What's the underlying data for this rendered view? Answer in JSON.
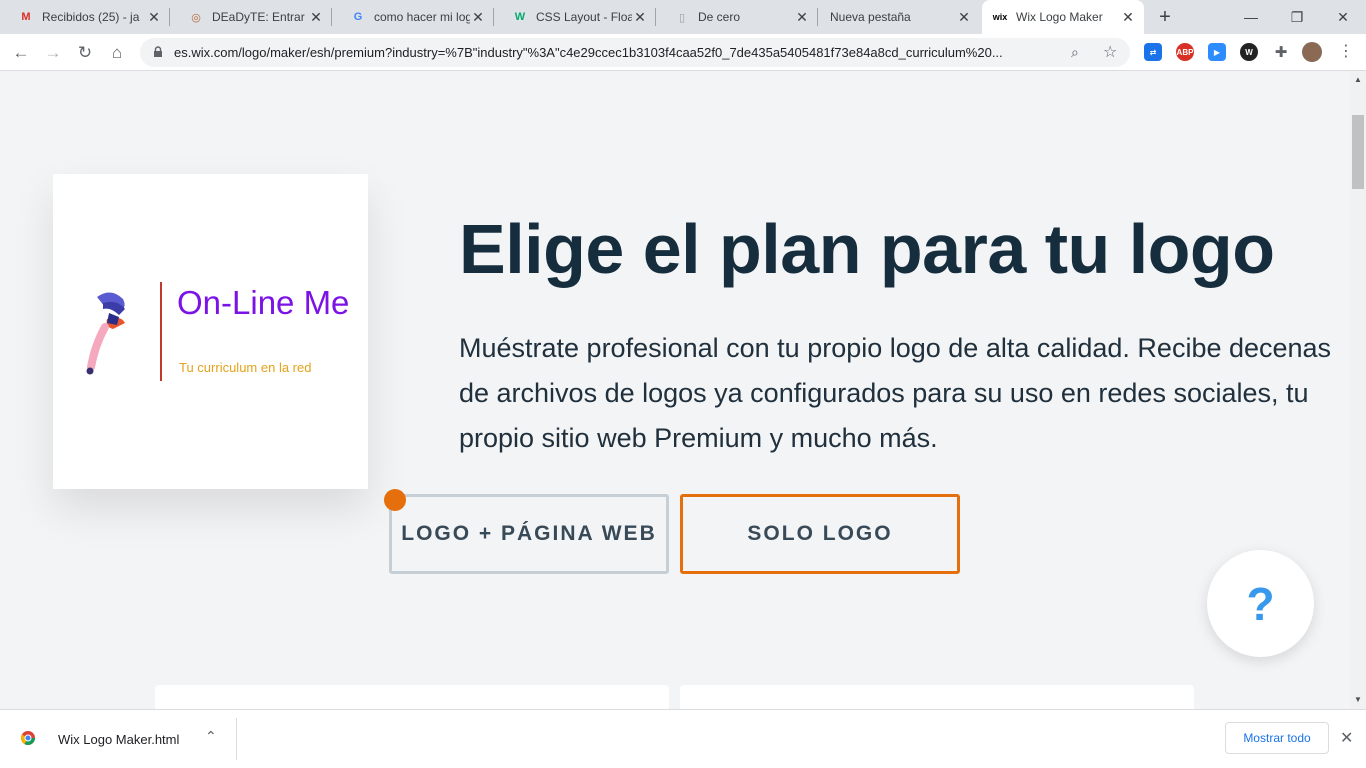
{
  "tabs": [
    {
      "title": "Recibidos (25) - ja",
      "icon": "gmail-icon",
      "glyph": "M",
      "color": "#d93025"
    },
    {
      "title": "DEaDyTE: Entrar al",
      "icon": "university-seal-icon",
      "glyph": "◎",
      "color": "#b06a3b"
    },
    {
      "title": "como hacer mi log",
      "icon": "google-icon",
      "glyph": "G",
      "color": "#4285f4"
    },
    {
      "title": "CSS Layout - Float",
      "icon": "w3schools-icon",
      "glyph": "W",
      "color": "#04aa6d"
    },
    {
      "title": "De cero",
      "icon": "document-icon",
      "glyph": "▯",
      "color": "#9aa0a6"
    },
    {
      "title": "Nueva pestaña",
      "icon": "",
      "glyph": "",
      "color": "#5f6368"
    },
    {
      "title": "Wix Logo Maker",
      "icon": "wix-icon",
      "glyph": "wix",
      "color": "#000000"
    }
  ],
  "address": {
    "url": "es.wix.com/logo/maker/esh/premium?industry=%7B\"industry\"%3A\"c4e29ccec1b3103f4caa52f0_7de435a5405481f73e84a8cd_curriculum%20..."
  },
  "logo_preview": {
    "name": "On-Line Me",
    "tagline": "Tu curriculum en la red"
  },
  "hero": {
    "headline": "Elige el plan para tu logo",
    "subtext": "Muéstrate profesional con tu propio logo de alta calidad. Recibe decenas de archivos de logos ya configurados para su uso en redes sociales, tu propio sitio web Premium y mucho más."
  },
  "plans": {
    "web_label": "LOGO + PÁGINA WEB",
    "solo_label": "SOLO LOGO"
  },
  "help": {
    "label": "?"
  },
  "download": {
    "filename": "Wix Logo Maker.html",
    "show_all": "Mostrar todo"
  },
  "colors": {
    "accent_orange": "#e56f0c",
    "headline": "#162d3d",
    "logo_purple": "#7b12e6",
    "logo_gold": "#e3a21b",
    "help_blue": "#3899ec"
  }
}
